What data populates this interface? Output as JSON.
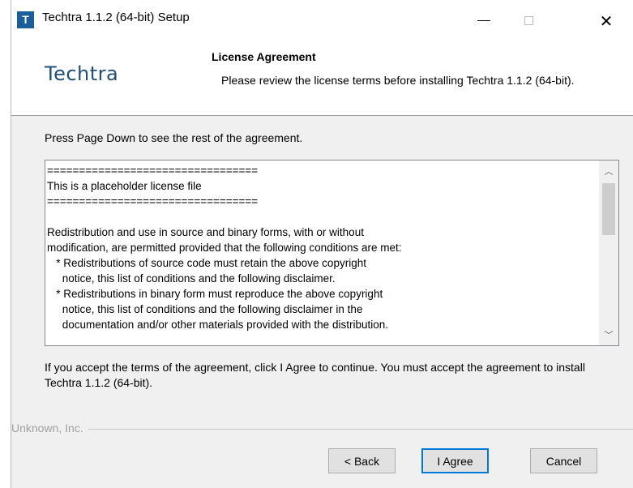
{
  "window": {
    "title": "Techtra 1.1.2 (64-bit) Setup",
    "icon_letter": "T",
    "controls": {
      "minimize": "minimize-icon",
      "maximize": "maximize-icon",
      "close": "close-icon"
    }
  },
  "header": {
    "brand": "Techtra",
    "title": "License Agreement",
    "subtitle": "Please review the license terms before installing Techtra 1.1.2 (64-bit)."
  },
  "body": {
    "instruction": "Press Page Down to see the rest of the agreement.",
    "license_lines": [
      "=================================",
      "This is a placeholder license file",
      "=================================",
      "",
      "Redistribution and use in source and binary forms, with or without",
      "modification, are permitted provided that the following conditions are met:",
      "   * Redistributions of source code must retain the above copyright",
      "     notice, this list of conditions and the following disclaimer.",
      "   * Redistributions in binary form must reproduce the above copyright",
      "     notice, this list of conditions and the following disclaimer in the",
      "     documentation and/or other materials provided with the distribution."
    ],
    "scroll_position": 0,
    "accept_text": "If you accept the terms of the agreement, click I Agree to continue. You must accept the agreement to install Techtra 1.1.2 (64-bit)."
  },
  "footer": {
    "vendor": "Unknown, Inc.",
    "buttons": {
      "back": "< Back",
      "agree": "I Agree",
      "cancel": "Cancel"
    }
  },
  "colors": {
    "brand": "#1f4e79",
    "focus_border": "#0078d7",
    "dialog_bg": "#f0f0f0"
  }
}
